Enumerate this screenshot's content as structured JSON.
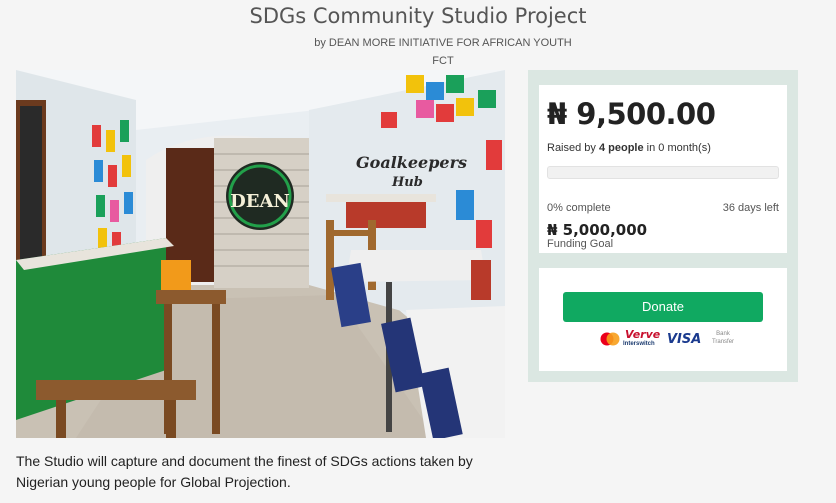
{
  "project": {
    "title": "SDGs Community Studio Project",
    "byline": "by DEAN MORE INITIATIVE FOR AFRICAN YOUTH",
    "location": "FCT",
    "description": "The Studio will capture and document the finest of SDGs actions taken by Nigerian young people for Global Projection."
  },
  "photo": {
    "sign_text": "DEAN",
    "wall_text_1": "Goalkeepers",
    "wall_text_2": "Hub"
  },
  "funding": {
    "amount_raised": "₦ 9,500.00",
    "raised_prefix": "Raised by ",
    "people": "4 people",
    "raised_suffix": " in 0 month(s)",
    "progress_fraction": 0.0,
    "percent_complete": "0% complete",
    "days_left": "36 days left",
    "goal_amount": "₦ 5,000,000",
    "goal_label": "Funding Goal"
  },
  "donate": {
    "button_label": "Donate",
    "payment_methods": {
      "verve": "Verve",
      "interswitch": "Interswitch",
      "visa": "VISA",
      "bank_transfer": "Bank Transfer"
    }
  },
  "colors": {
    "accent": "#10a961",
    "sidebar_bg": "#dbe7e2"
  }
}
